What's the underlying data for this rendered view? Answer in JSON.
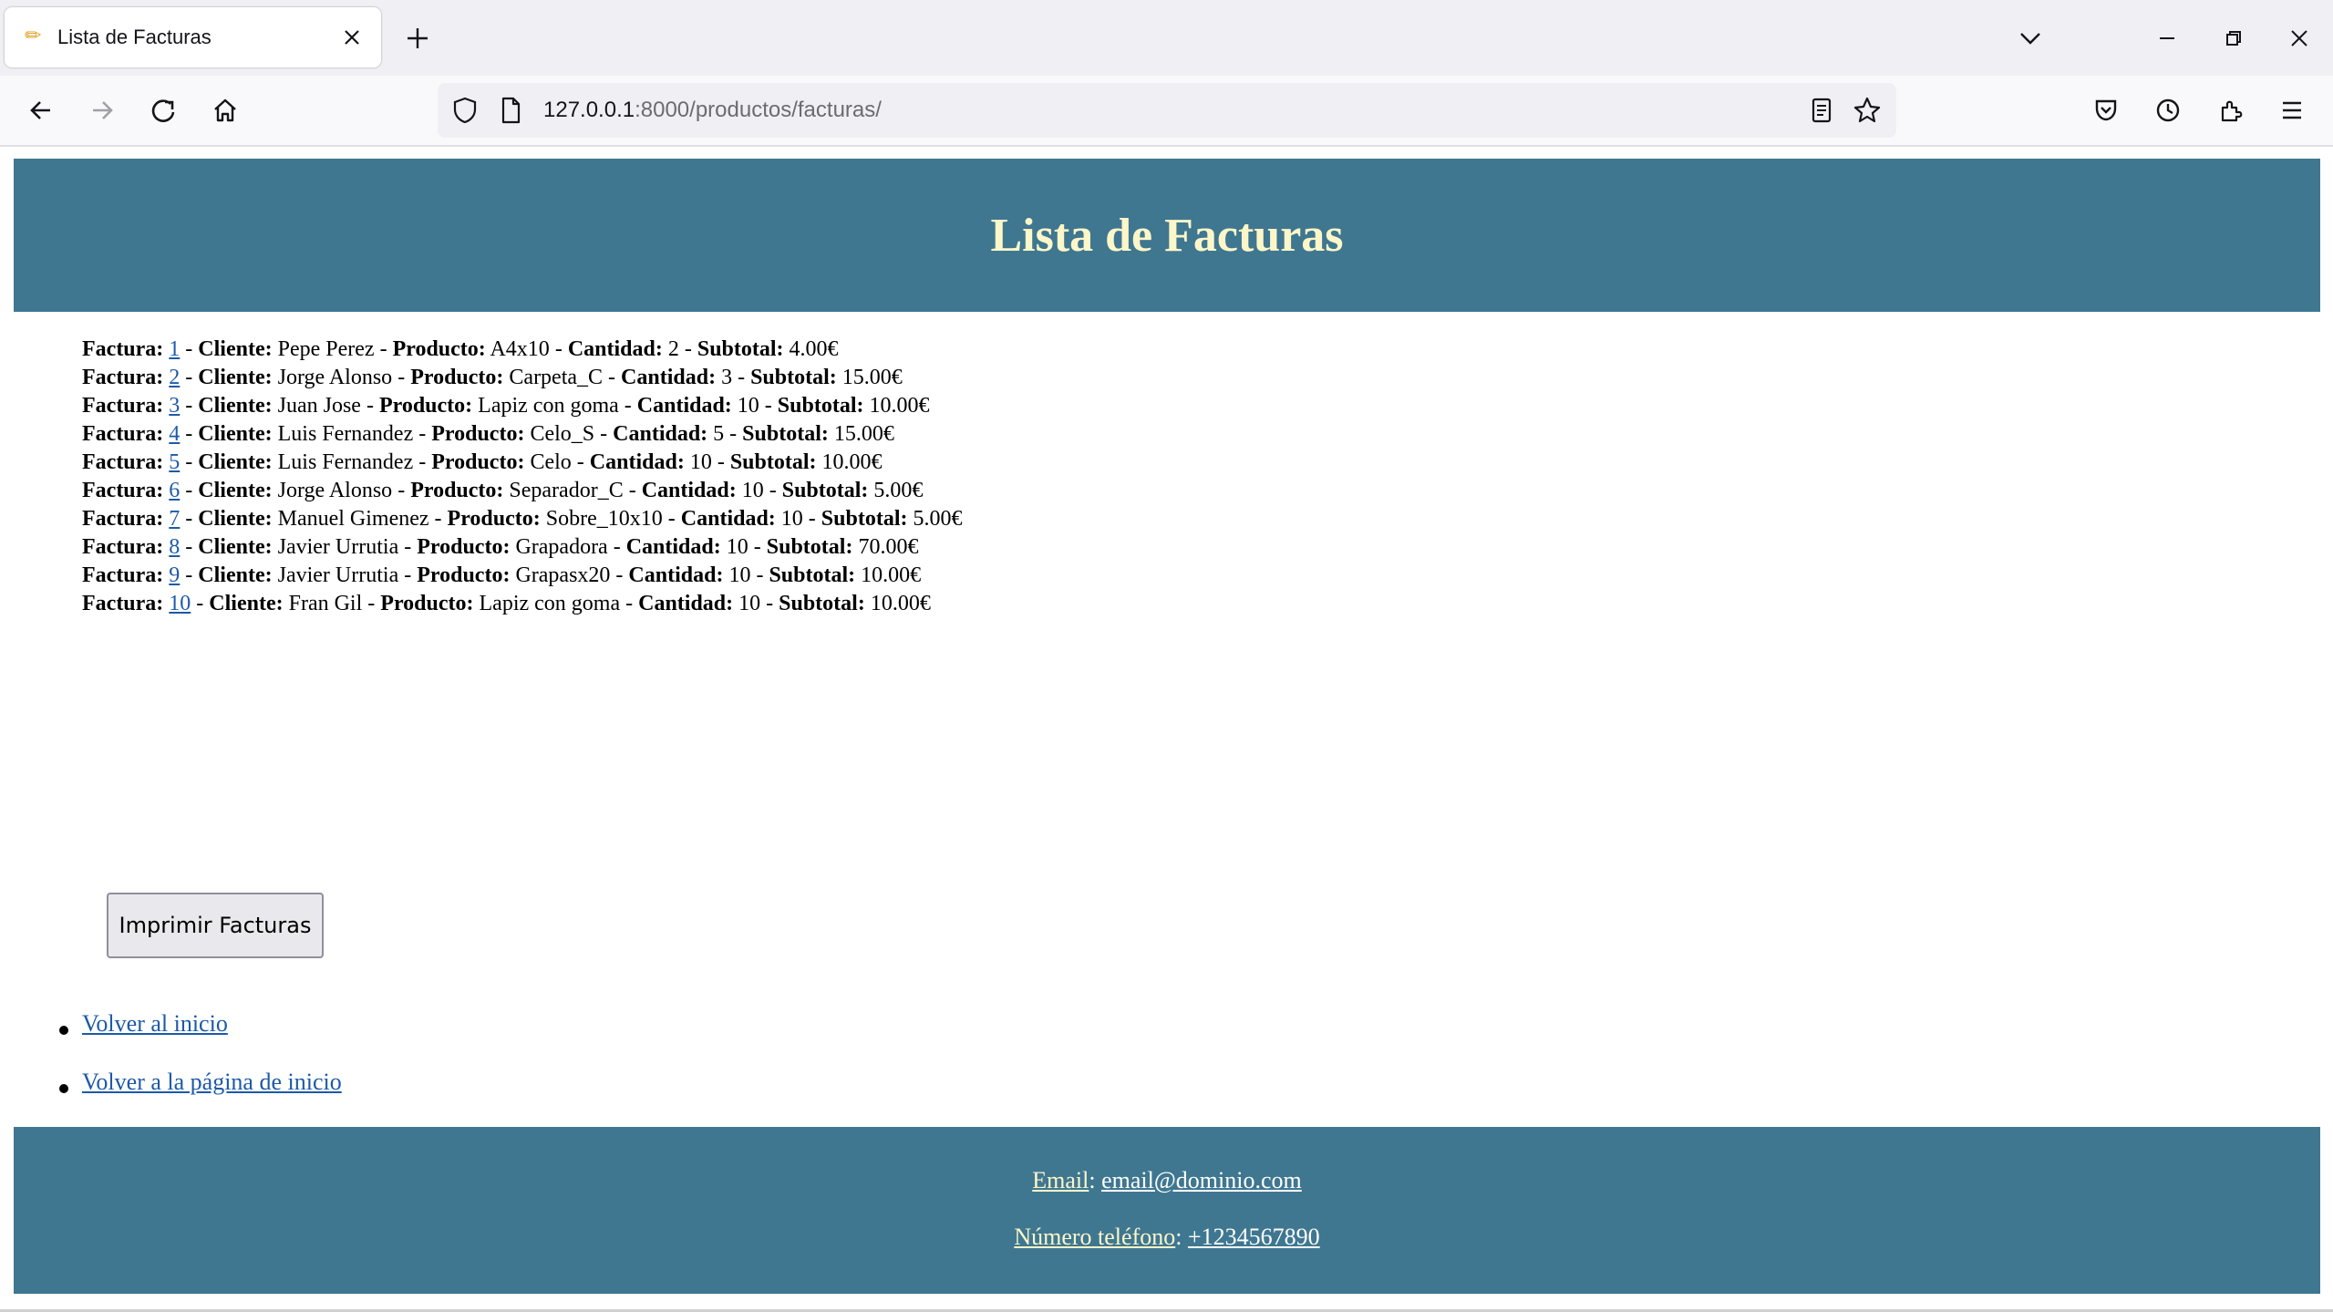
{
  "browser": {
    "tab_title": "Lista de Facturas",
    "url_host": "127.0.0.1",
    "url_path": ":8000/productos/facturas/"
  },
  "page": {
    "title": "Lista de Facturas",
    "labels": {
      "factura": "Factura:",
      "cliente": "Cliente:",
      "producto": "Producto:",
      "cantidad": "Cantidad:",
      "subtotal": "Subtotal:"
    },
    "invoices": [
      {
        "id": "1",
        "cliente": "Pepe Perez",
        "producto": "A4x10",
        "cantidad": "2",
        "subtotal": "4.00€"
      },
      {
        "id": "2",
        "cliente": "Jorge Alonso",
        "producto": "Carpeta_C",
        "cantidad": "3",
        "subtotal": "15.00€"
      },
      {
        "id": "3",
        "cliente": "Juan Jose",
        "producto": "Lapiz con goma",
        "cantidad": "10",
        "subtotal": "10.00€"
      },
      {
        "id": "4",
        "cliente": "Luis Fernandez",
        "producto": "Celo_S",
        "cantidad": "5",
        "subtotal": "15.00€"
      },
      {
        "id": "5",
        "cliente": "Luis Fernandez",
        "producto": "Celo",
        "cantidad": "10",
        "subtotal": "10.00€"
      },
      {
        "id": "6",
        "cliente": "Jorge Alonso",
        "producto": "Separador_C",
        "cantidad": "10",
        "subtotal": "5.00€"
      },
      {
        "id": "7",
        "cliente": "Manuel Gimenez",
        "producto": "Sobre_10x10",
        "cantidad": "10",
        "subtotal": "5.00€"
      },
      {
        "id": "8",
        "cliente": "Javier Urrutia",
        "producto": "Grapadora",
        "cantidad": "10",
        "subtotal": "70.00€"
      },
      {
        "id": "9",
        "cliente": "Javier Urrutia",
        "producto": "Grapasx20",
        "cantidad": "10",
        "subtotal": "10.00€"
      },
      {
        "id": "10",
        "cliente": "Fran Gil",
        "producto": "Lapiz con goma",
        "cantidad": "10",
        "subtotal": "10.00€"
      }
    ],
    "print_button": "Imprimir Facturas",
    "links": [
      "Volver al inicio",
      "Volver a la página de inicio"
    ]
  },
  "footer": {
    "email_label": "Email",
    "email_value": "email@dominio.com",
    "phone_label": "Número teléfono",
    "phone_value": "+1234567890"
  },
  "colors": {
    "header_bg": "#3f7791",
    "title_color": "#fdf6c8",
    "link_color": "#1c5aa8"
  },
  "icons": [
    "pencil-favicon-icon",
    "close-icon",
    "plus-icon",
    "chevron-down-icon",
    "minimize-icon",
    "restore-icon",
    "back-arrow-icon",
    "forward-arrow-icon",
    "reload-icon",
    "home-icon",
    "shield-icon",
    "page-icon",
    "reader-view-icon",
    "bookmark-star-icon",
    "pocket-icon",
    "history-icon",
    "extensions-icon",
    "hamburger-menu-icon"
  ]
}
